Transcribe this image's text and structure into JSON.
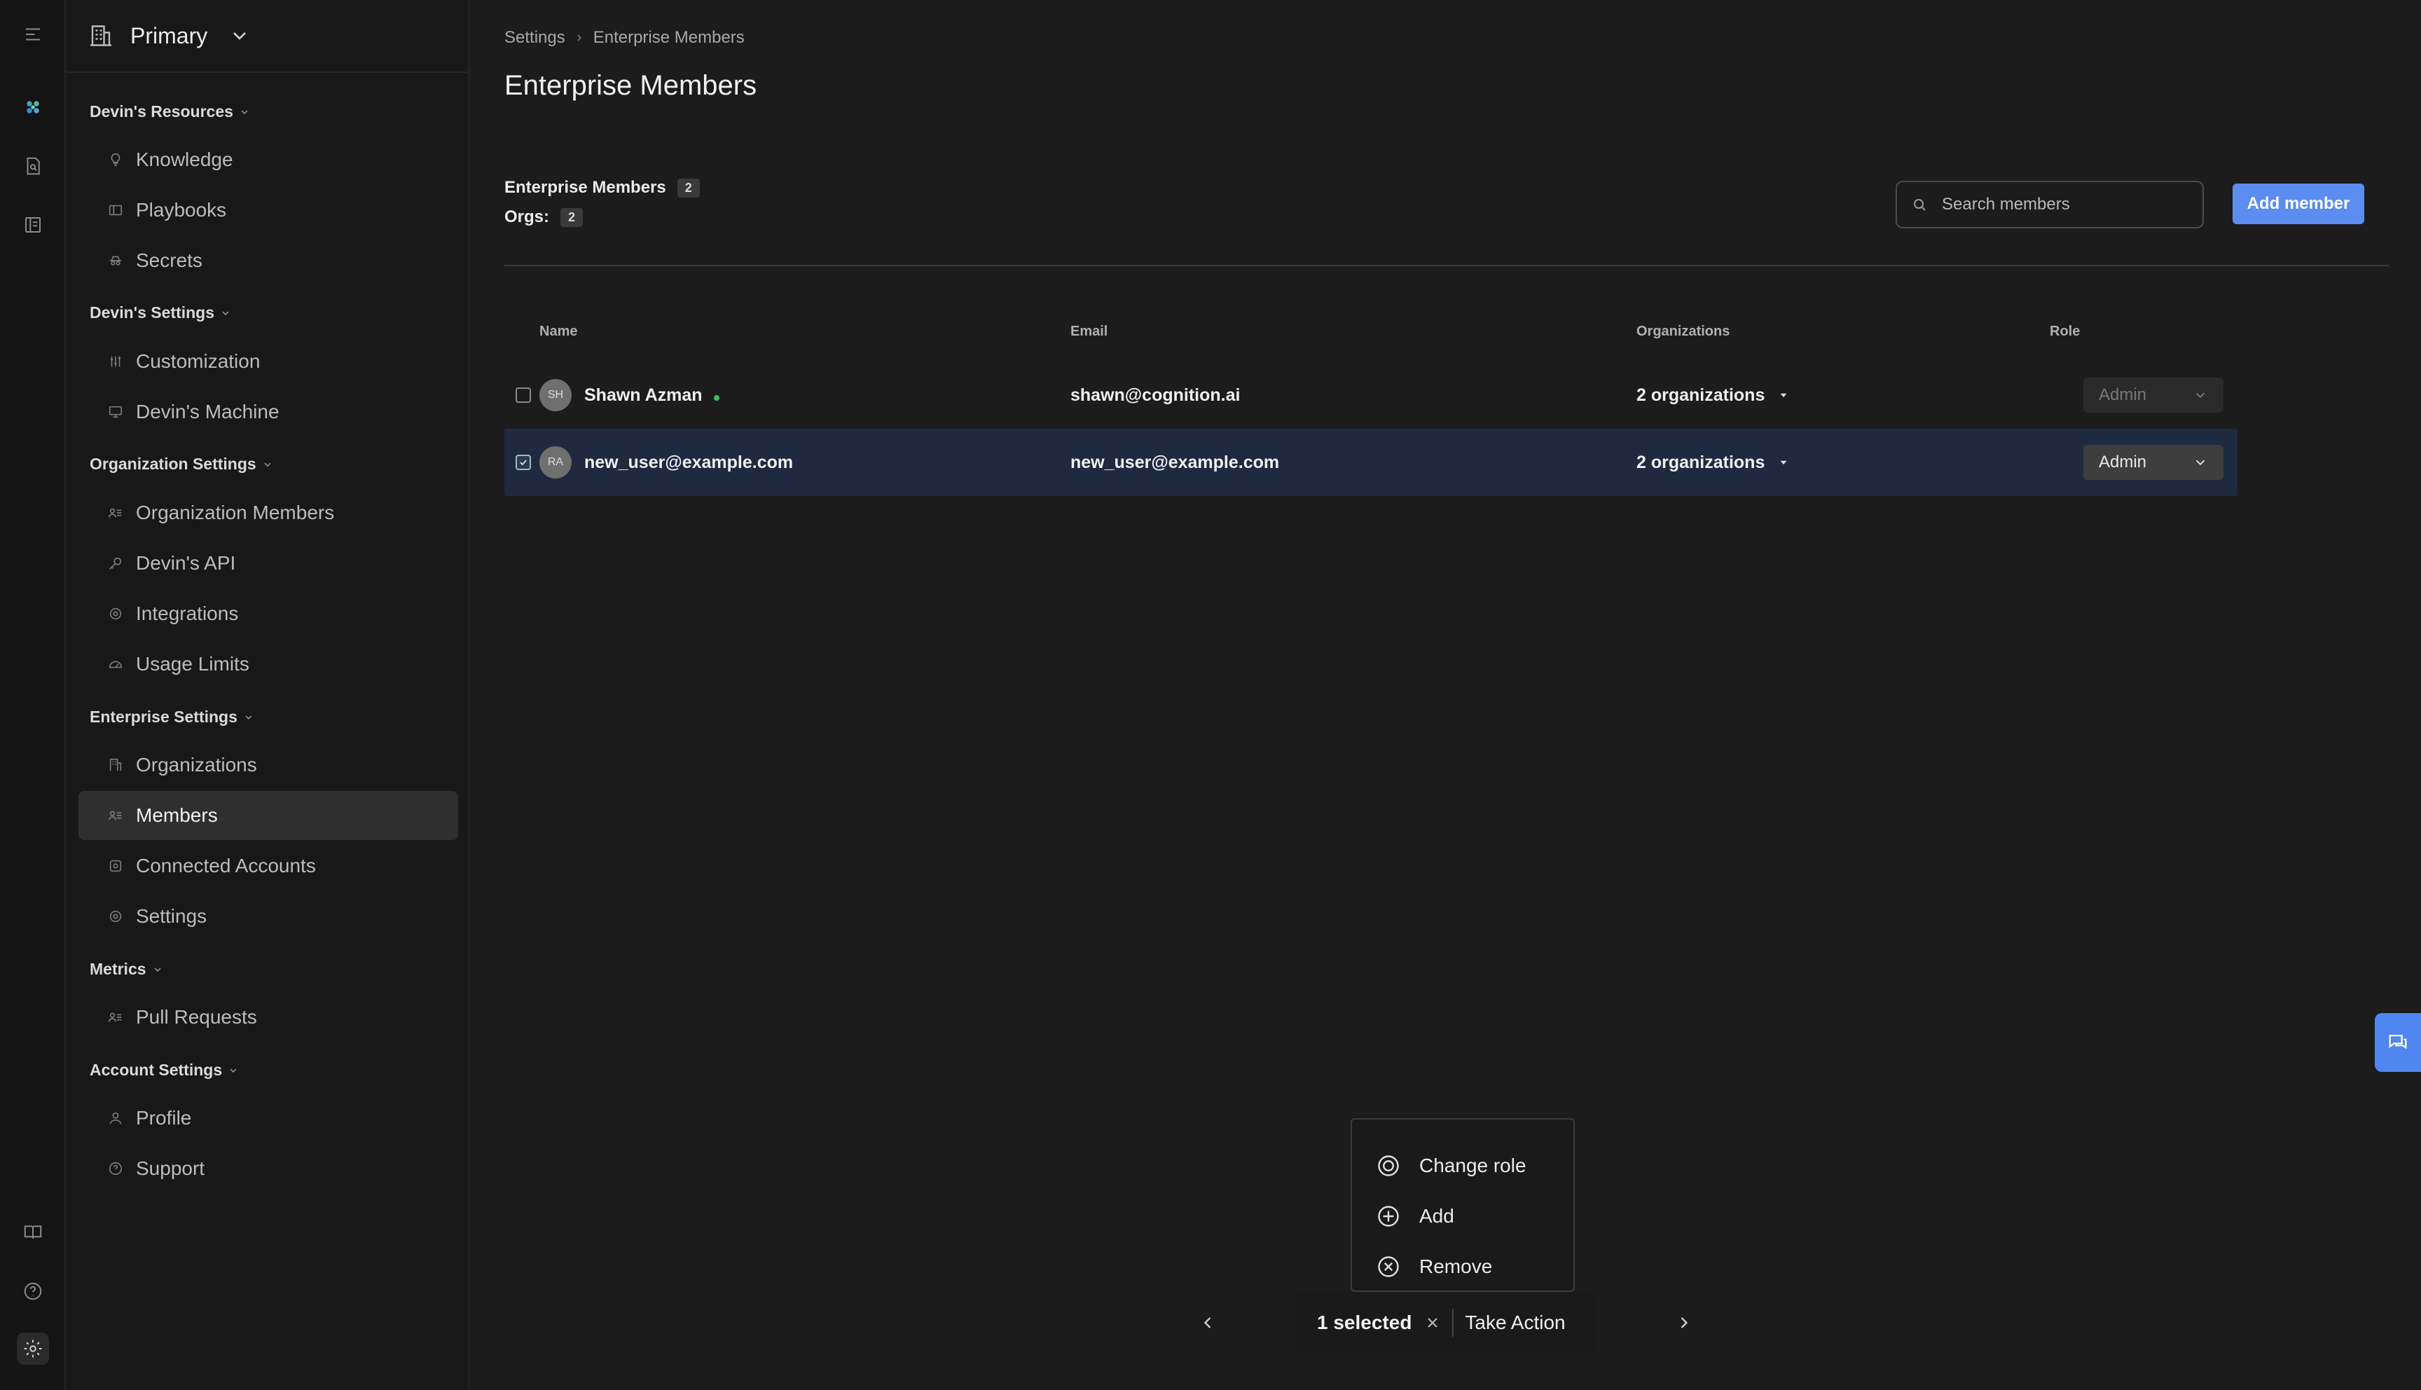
{
  "org_switcher": {
    "name": "Primary"
  },
  "sidebar": {
    "sections": [
      {
        "title": "Devin's Resources",
        "items": [
          "Knowledge",
          "Playbooks",
          "Secrets"
        ]
      },
      {
        "title": "Devin's Settings",
        "items": [
          "Customization",
          "Devin's Machine"
        ]
      },
      {
        "title": "Organization Settings",
        "items": [
          "Organization Members",
          "Devin's API",
          "Integrations",
          "Usage Limits"
        ]
      },
      {
        "title": "Enterprise Settings",
        "items": [
          "Organizations",
          "Members",
          "Connected Accounts",
          "Settings"
        ]
      },
      {
        "title": "Metrics",
        "items": [
          "Pull Requests"
        ]
      },
      {
        "title": "Account Settings",
        "items": [
          "Profile",
          "Support"
        ]
      }
    ],
    "active_item": "Members"
  },
  "breadcrumb": {
    "parent": "Settings",
    "current": "Enterprise Members"
  },
  "page": {
    "title": "Enterprise Members"
  },
  "summary": {
    "members_label": "Enterprise Members",
    "members_count": "2",
    "orgs_label": "Orgs:",
    "orgs_count": "2"
  },
  "search": {
    "placeholder": "Search members"
  },
  "add_member_label": "Add member",
  "table": {
    "headers": {
      "name": "Name",
      "email": "Email",
      "organizations": "Organizations",
      "role": "Role"
    },
    "rows": [
      {
        "initials": "SH",
        "name": "Shawn Azman",
        "email": "shawn@cognition.ai",
        "organizations": "2 organizations",
        "role": "Admin",
        "checked": false,
        "online": true
      },
      {
        "initials": "RA",
        "name": "new_user@example.com",
        "email": "new_user@example.com",
        "organizations": "2 organizations",
        "role": "Admin",
        "checked": true,
        "online": false
      }
    ]
  },
  "action_menu": {
    "items": [
      "Change role",
      "Add",
      "Remove"
    ]
  },
  "selection_bar": {
    "count_label": "1 selected",
    "action_label": "Take Action"
  },
  "colors": {
    "accent": "#5b8ef0",
    "selected_row": "#1f2a40",
    "online": "#3fbf5f"
  }
}
